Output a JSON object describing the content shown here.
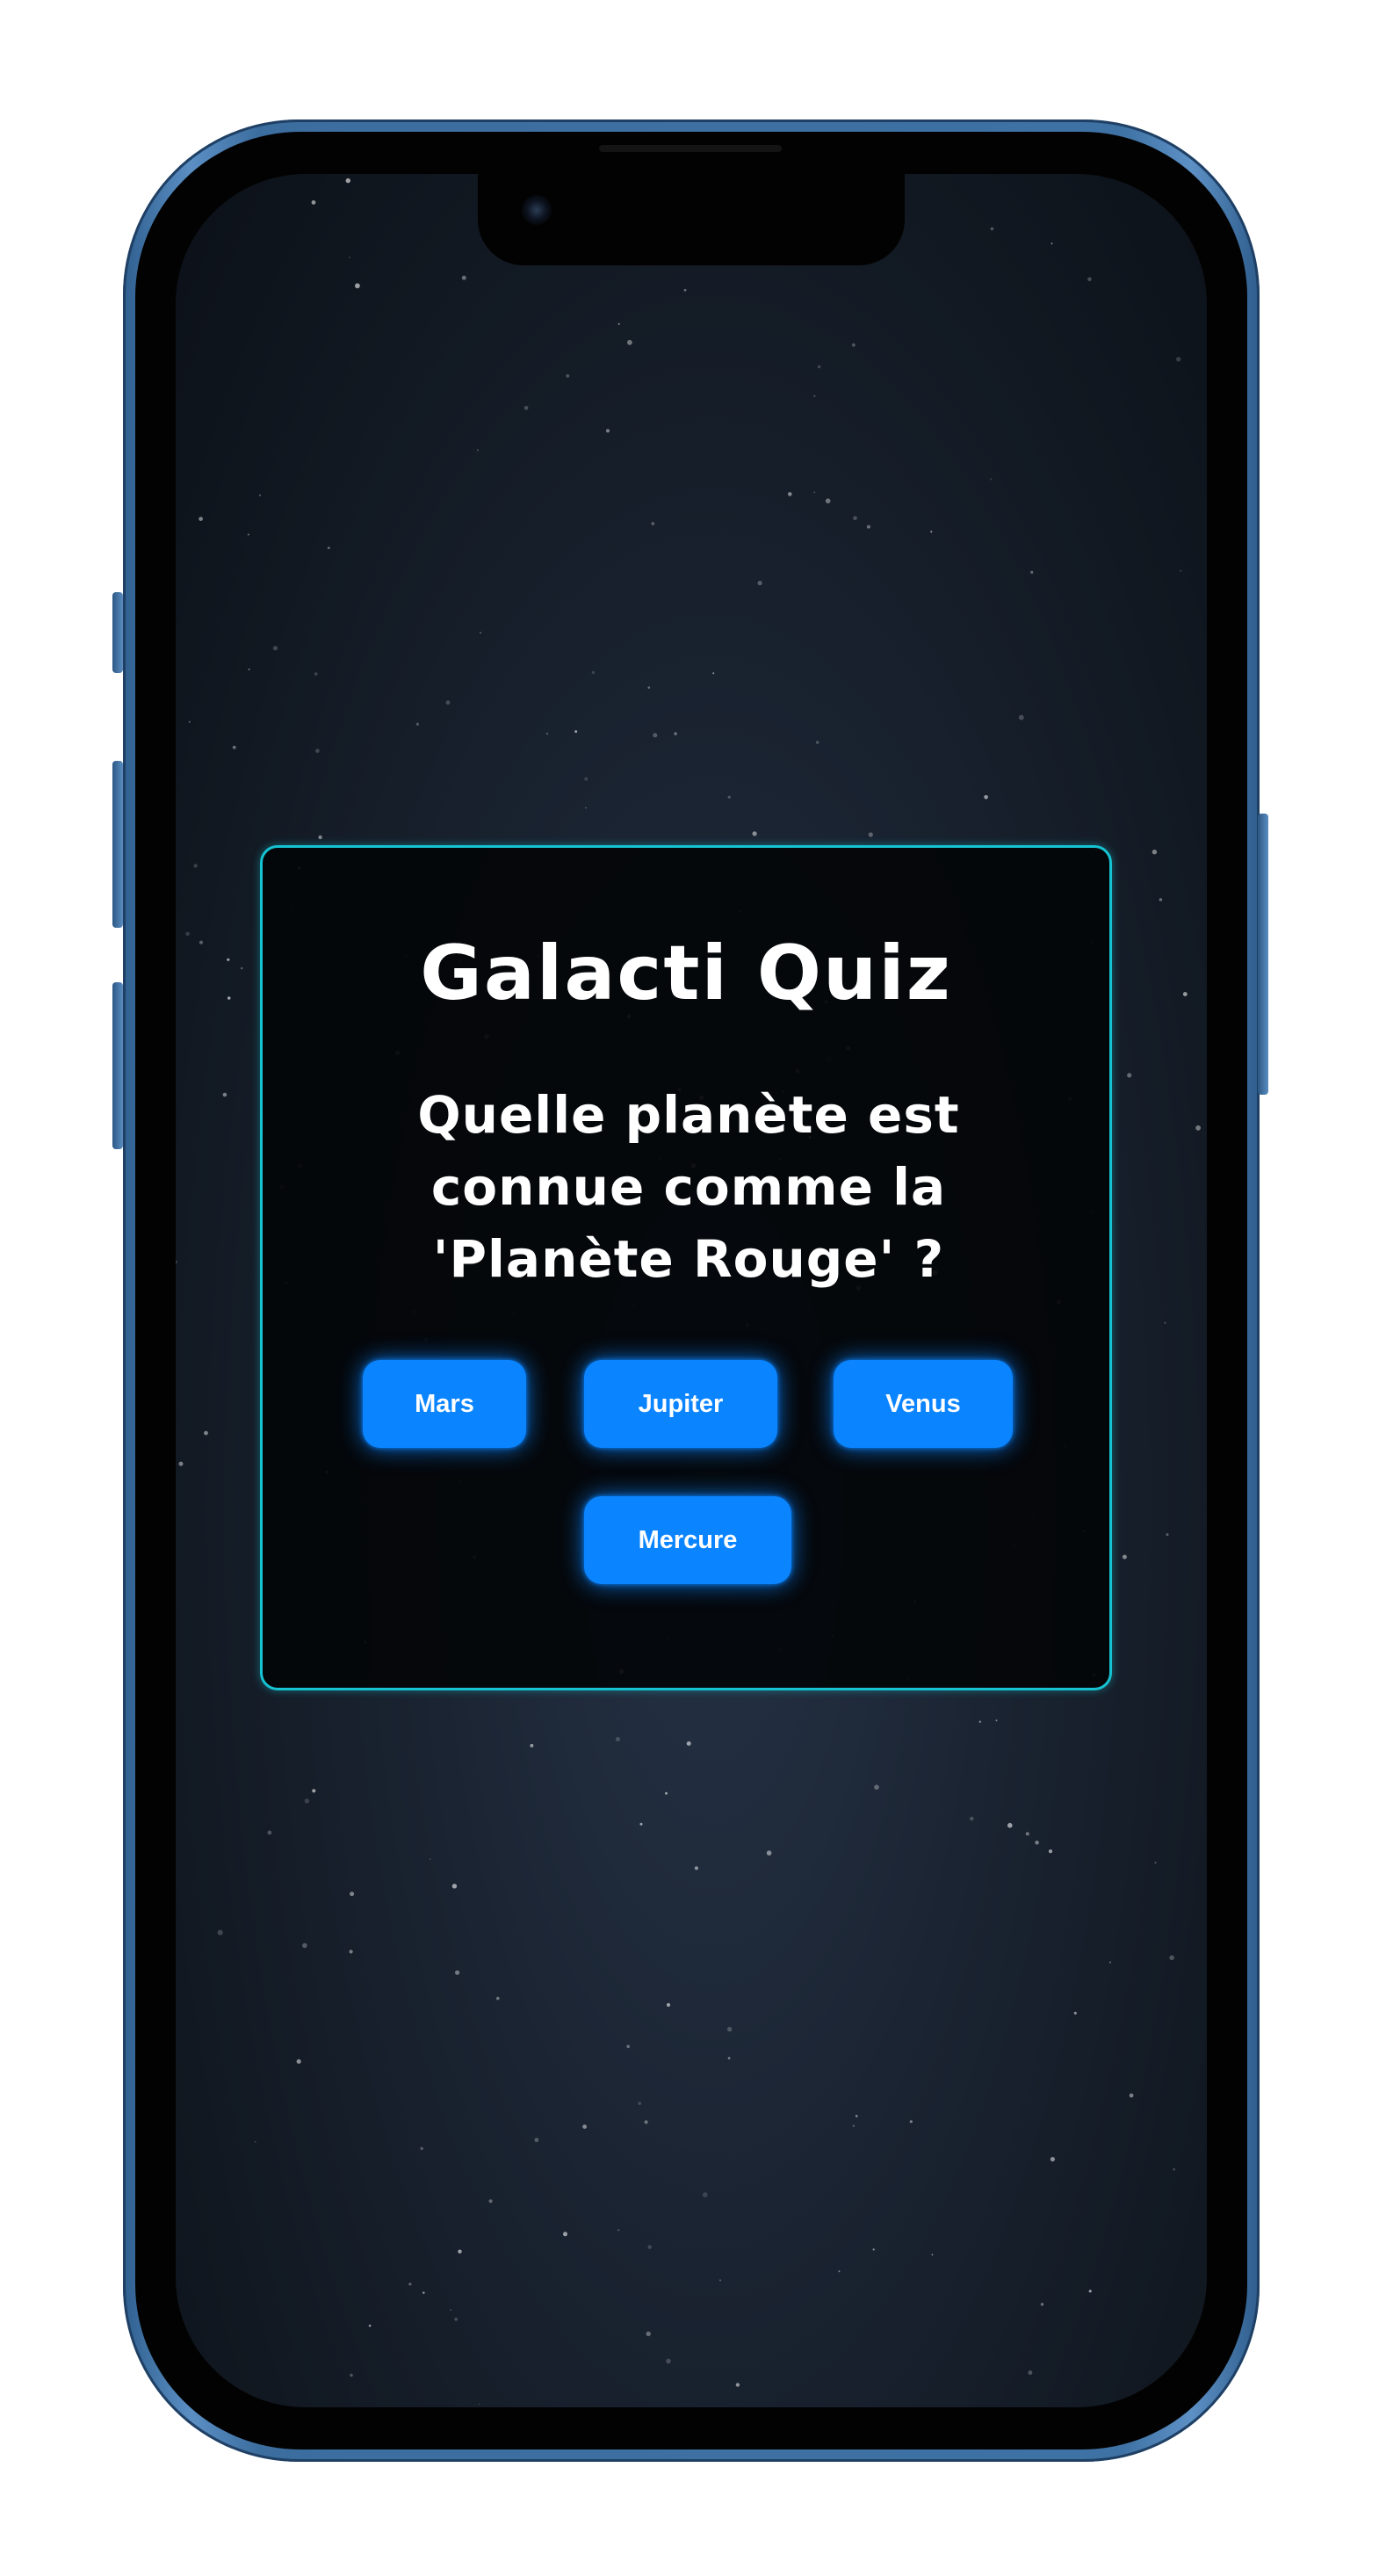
{
  "theme": {
    "accent_border": "#16c3d2",
    "button_color": "#0a84ff",
    "frame_color": "#3f72a4",
    "background": "#141b25"
  },
  "device": {
    "camera_icon": "front-camera-icon"
  },
  "quiz": {
    "title": "Galacti Quiz",
    "question": "Quelle planète est connue comme la 'Planète Rouge' ?",
    "answers": [
      "Mars",
      "Jupiter",
      "Venus",
      "Mercure"
    ]
  }
}
